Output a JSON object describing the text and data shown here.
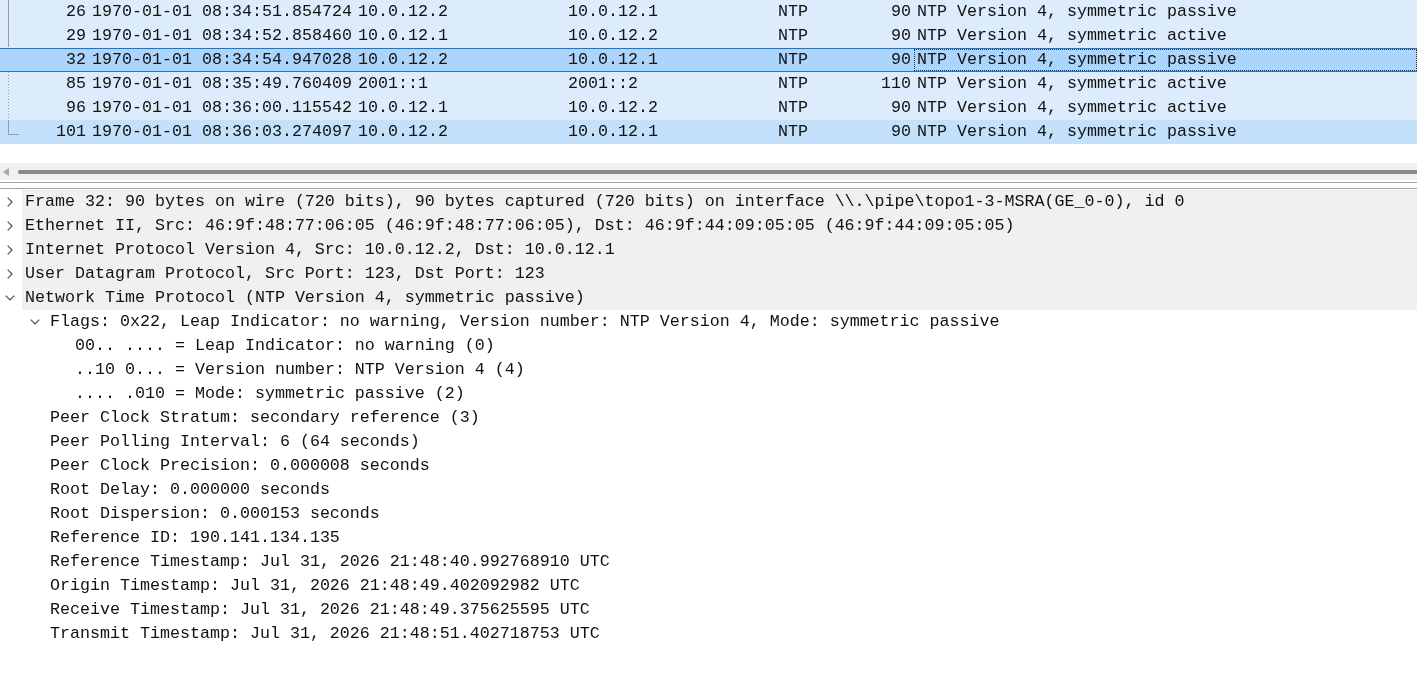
{
  "packet_list": {
    "rows": [
      {
        "cells": [
          "26",
          "1970-01-01 08:34:51.854724",
          "10.0.12.2",
          "10.0.12.1",
          "NTP",
          "90",
          "NTP Version 4, symmetric passive"
        ],
        "selected": false,
        "hovered": false
      },
      {
        "cells": [
          "29",
          "1970-01-01 08:34:52.858460",
          "10.0.12.1",
          "10.0.12.2",
          "NTP",
          "90",
          "NTP Version 4, symmetric active"
        ],
        "selected": false,
        "hovered": false
      },
      {
        "cells": [
          "32",
          "1970-01-01 08:34:54.947028",
          "10.0.12.2",
          "10.0.12.1",
          "NTP",
          "90",
          "NTP Version 4, symmetric passive"
        ],
        "selected": true,
        "hovered": false
      },
      {
        "cells": [
          "85",
          "1970-01-01 08:35:49.760409",
          "2001::1",
          "2001::2",
          "NTP",
          "110",
          "NTP Version 4, symmetric active"
        ],
        "selected": false,
        "hovered": false
      },
      {
        "cells": [
          "96",
          "1970-01-01 08:36:00.115542",
          "10.0.12.1",
          "10.0.12.2",
          "NTP",
          "90",
          "NTP Version 4, symmetric active"
        ],
        "selected": false,
        "hovered": false
      },
      {
        "cells": [
          "101",
          "1970-01-01 08:36:03.274097",
          "10.0.12.2",
          "10.0.12.1",
          "NTP",
          "90",
          "NTP Version 4, symmetric passive"
        ],
        "selected": false,
        "hovered": true
      }
    ]
  },
  "packet_details": {
    "items": [
      {
        "text": "Frame 32: 90 bytes on wire (720 bits), 90 bytes captured (720 bits) on interface \\\\.\\pipe\\topo1-3-MSRA(GE_0-0), id 0",
        "expanded": false
      },
      {
        "text": "Ethernet II, Src: 46:9f:48:77:06:05 (46:9f:48:77:06:05), Dst: 46:9f:44:09:05:05 (46:9f:44:09:05:05)",
        "expanded": false
      },
      {
        "text": "Internet Protocol Version 4, Src: 10.0.12.2, Dst: 10.0.12.1",
        "expanded": false
      },
      {
        "text": "User Datagram Protocol, Src Port: 123, Dst Port: 123",
        "expanded": false
      },
      {
        "text": "Network Time Protocol (NTP Version 4, symmetric passive)",
        "expanded": true,
        "children": [
          {
            "text": "Flags: 0x22, Leap Indicator: no warning, Version number: NTP Version 4, Mode: symmetric passive",
            "expanded": true,
            "children": [
              {
                "text": "00.. .... = Leap Indicator: no warning (0)"
              },
              {
                "text": "..10 0... = Version number: NTP Version 4 (4)"
              },
              {
                "text": ".... .010 = Mode: symmetric passive (2)"
              }
            ]
          },
          {
            "text": "Peer Clock Stratum: secondary reference (3)"
          },
          {
            "text": "Peer Polling Interval: 6 (64 seconds)"
          },
          {
            "text": "Peer Clock Precision: 0.000008 seconds"
          },
          {
            "text": "Root Delay: 0.000000 seconds"
          },
          {
            "text": "Root Dispersion: 0.000153 seconds"
          },
          {
            "text": "Reference ID: 190.141.134.135"
          },
          {
            "text": "Reference Timestamp: Jul 31, 2026 21:48:40.992768910 UTC"
          },
          {
            "text": "Origin Timestamp: Jul 31, 2026 21:48:49.402092982 UTC"
          },
          {
            "text": "Receive Timestamp: Jul 31, 2026 21:48:49.375625595 UTC"
          },
          {
            "text": "Transmit Timestamp: Jul 31, 2026 21:48:51.402718753 UTC"
          }
        ]
      }
    ]
  }
}
